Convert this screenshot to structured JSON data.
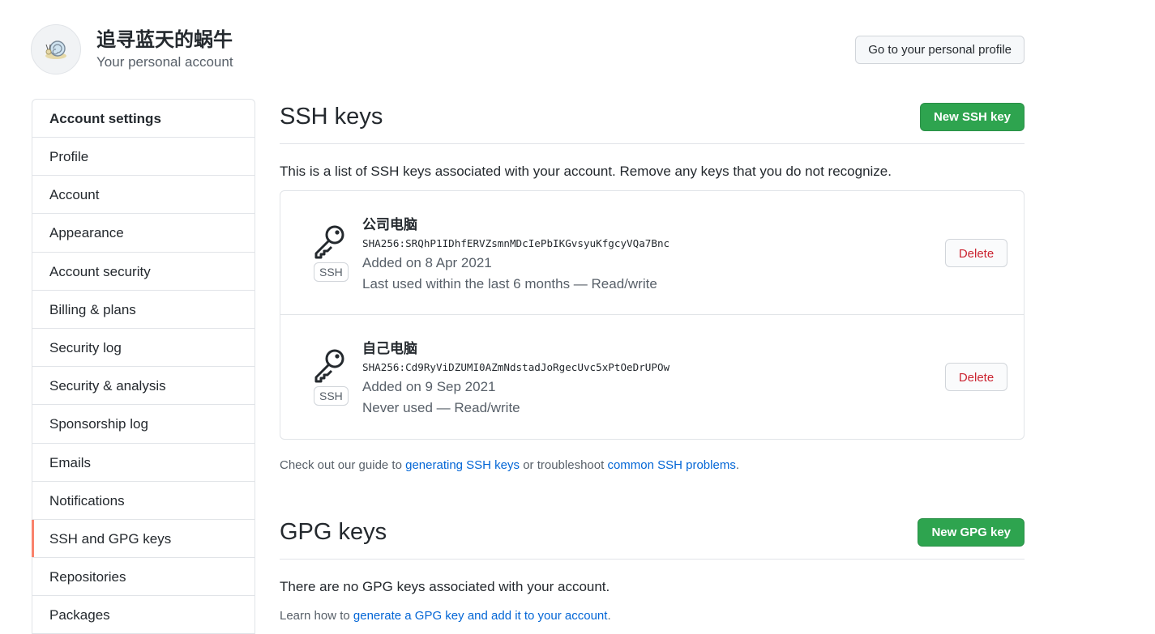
{
  "header": {
    "name": "追寻蓝天的蜗牛",
    "subtitle": "Your personal account",
    "profile_button": "Go to your personal profile"
  },
  "sidebar": {
    "heading": "Account settings",
    "items": [
      {
        "label": "Profile"
      },
      {
        "label": "Account"
      },
      {
        "label": "Appearance"
      },
      {
        "label": "Account security"
      },
      {
        "label": "Billing & plans"
      },
      {
        "label": "Security log"
      },
      {
        "label": "Security & analysis"
      },
      {
        "label": "Sponsorship log"
      },
      {
        "label": "Emails"
      },
      {
        "label": "Notifications"
      },
      {
        "label": "SSH and GPG keys",
        "selected": true
      },
      {
        "label": "Repositories"
      },
      {
        "label": "Packages"
      }
    ]
  },
  "ssh": {
    "title": "SSH keys",
    "new_button": "New SSH key",
    "intro": "This is a list of SSH keys associated with your account. Remove any keys that you do not recognize.",
    "keys": [
      {
        "title": "公司电脑",
        "fingerprint": "SHA256:SRQhP1IDhfERVZsmnMDcIePbIKGvsyuKfgcyVQa7Bnc",
        "added": "Added on 8 Apr 2021",
        "usage": "Last used within the last 6 months — Read/write",
        "type_label": "SSH",
        "delete_label": "Delete"
      },
      {
        "title": "自己电脑",
        "fingerprint": "SHA256:Cd9RyViDZUMI0AZmNdstadJoRgecUvc5xPtOeDrUPOw",
        "added": "Added on 9 Sep 2021",
        "usage": "Never used — Read/write",
        "type_label": "SSH",
        "delete_label": "Delete"
      }
    ],
    "guide_prefix": "Check out our guide to ",
    "guide_link1": "generating SSH keys",
    "guide_middle": " or troubleshoot ",
    "guide_link2": "common SSH problems",
    "guide_suffix": "."
  },
  "gpg": {
    "title": "GPG keys",
    "new_button": "New GPG key",
    "empty": "There are no GPG keys associated with your account.",
    "learn_prefix": "Learn how to ",
    "learn_link": "generate a GPG key and add it to your account",
    "learn_suffix": "."
  },
  "colors": {
    "primary_button": "#2ea44f",
    "link": "#0366d6",
    "danger": "#cb2431",
    "selected_indicator": "#f9826c"
  }
}
